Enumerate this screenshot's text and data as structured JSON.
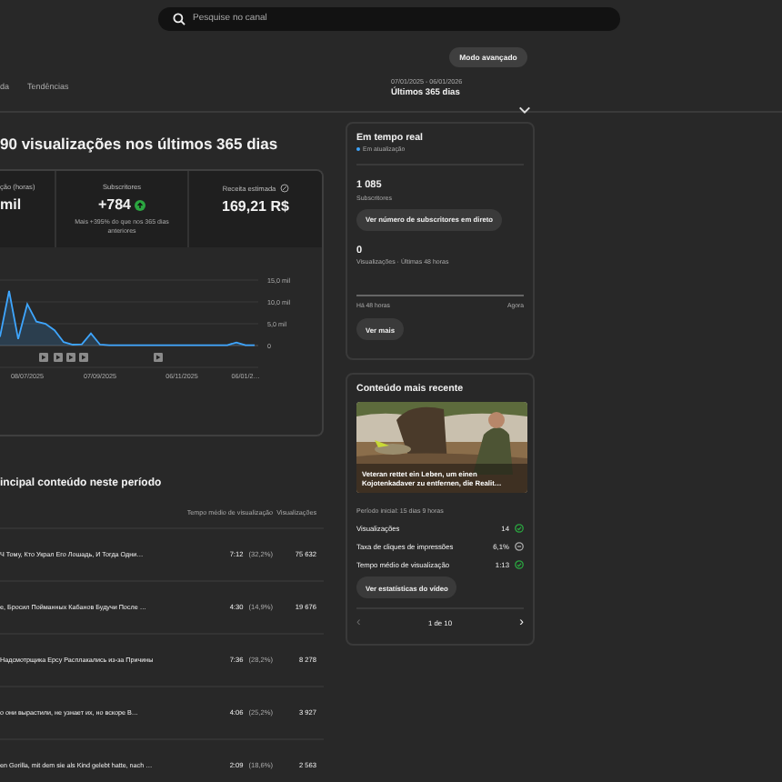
{
  "search": {
    "placeholder": "Pesquise no canal"
  },
  "mode_button": "Modo avançado",
  "tabs": [
    {
      "label": "da",
      "selected": false
    },
    {
      "label": "Tendências",
      "selected": false
    }
  ],
  "date_range": {
    "dates": "07/01/2025 - 06/01/2026",
    "label": "Últimos 365 dias"
  },
  "headline": "90 visualizações nos últimos 365 dias",
  "metrics": [
    {
      "label": "ção (horas)",
      "value": "mil",
      "kind": "plain"
    },
    {
      "label": "Subscritores",
      "value": "+784",
      "note": "Mais +395% do que nos 365 dias anteriores",
      "kind": "up"
    },
    {
      "label": "Receita estimada",
      "value": "169,21 R$",
      "kind": "info"
    }
  ],
  "chart_data": {
    "type": "area",
    "categories": [
      null,
      null,
      null,
      "08/07/2025",
      null,
      null,
      null,
      null,
      null,
      null,
      null,
      "07/09/2025",
      null,
      null,
      null,
      null,
      null,
      null,
      null,
      null,
      "06/11/2025",
      null,
      null,
      null,
      null,
      null,
      null,
      "06/01/2…",
      null
    ],
    "ylim": [
      0,
      15
    ],
    "yticks": [
      {
        "value": 0,
        "label": "0"
      },
      {
        "value": 5,
        "label": "5,0 mil"
      },
      {
        "value": 10,
        "label": "10,0 mil"
      },
      {
        "value": 15,
        "label": "15,0 mil"
      }
    ],
    "series": [
      {
        "color": "#3ea6ff",
        "values": [
          2,
          12.5,
          1.5,
          9.5,
          5.5,
          5,
          3.5,
          0.8,
          0.2,
          0.3,
          2.8,
          0.2,
          0.1,
          0.1,
          0.1,
          0.1,
          0.1,
          0.1,
          0.1,
          0.1,
          0.1,
          0.1,
          0.1,
          0.1,
          0.1,
          0.1,
          0.7,
          0.1,
          0.1
        ]
      }
    ]
  },
  "top_content": {
    "title": "incipal conteúdo neste período",
    "columns": [
      "Tempo médio de visualização",
      "Visualizações"
    ],
    "rows": [
      {
        "title": "Ч Тому, Кто Украл Его Лошадь, И Тогда Одни…",
        "avg": "7:12",
        "pct": "(32,2%)",
        "views": "75 632"
      },
      {
        "title": "е, Бросил Пойманных Кабанов Будучи После …",
        "avg": "4:30",
        "pct": "(14,9%)",
        "views": "19 676"
      },
      {
        "title": "Надсмотрщика Ерсу Расплакались из-за Причины",
        "avg": "7:36",
        "pct": "(28,2%)",
        "views": "8 278"
      },
      {
        "title": "о они вырастили, не узнает их, но вскоре В…",
        "avg": "4:06",
        "pct": "(25,2%)",
        "views": "3 927"
      },
      {
        "title": "en Gorilla, mit dem sie als Kind gelebt hatte, nach …",
        "avg": "2:09",
        "pct": "(18,6%)",
        "views": "2 563"
      }
    ]
  },
  "realtime": {
    "title": "Em tempo real",
    "status": "Em atualização",
    "subs": "1 085",
    "subs_label": "Subscritores",
    "subs_button": "Ver número de subscritores em direto",
    "views": "0",
    "views_label": "Visualizações · Últimas 48 horas",
    "from": "Há 48 horas",
    "to": "Agora",
    "more_button": "Ver mais"
  },
  "recent": {
    "title": "Conteúdo mais recente",
    "video_title": "Veteran rettet ein Leben, um einen Kojotenkadaver zu entfernen, die Realit…",
    "period": "Período inicial: 15 dias 9 horas",
    "stats": [
      {
        "label": "Visualizações",
        "value": "14",
        "kind": "good"
      },
      {
        "label": "Taxa de cliques de impressões",
        "value": "6,1%",
        "kind": "neutral"
      },
      {
        "label": "Tempo médio de visualização",
        "value": "1:13",
        "kind": "good"
      }
    ],
    "button": "Ver estatísticas do vídeo",
    "prev": "‹",
    "pager": "1 de 10",
    "next": "›"
  }
}
